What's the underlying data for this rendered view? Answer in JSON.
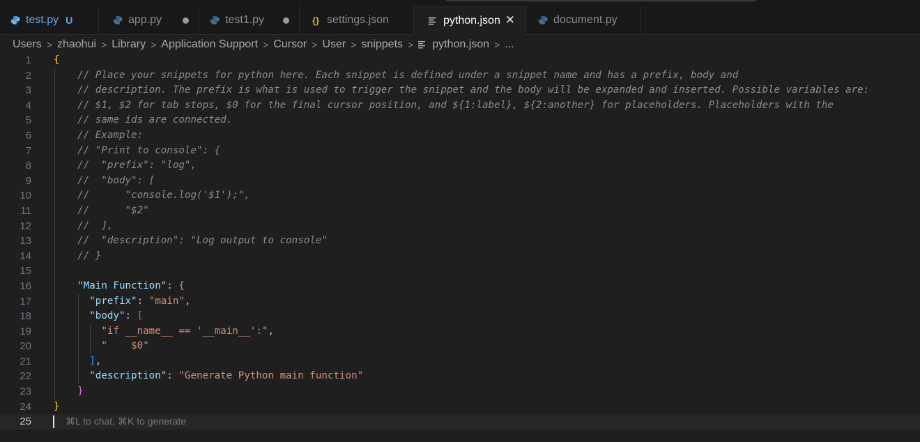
{
  "tabs": [
    {
      "label": "test.py",
      "icon": "python-icon",
      "marker": "U",
      "state": "modified-untracked"
    },
    {
      "label": "app.py",
      "icon": "python-icon",
      "marker": "dot",
      "state": "unsaved"
    },
    {
      "label": "test1.py",
      "icon": "python-icon",
      "marker": "dot",
      "state": "unsaved"
    },
    {
      "label": "settings.json",
      "icon": "json-braces-icon",
      "marker": "",
      "state": "normal"
    },
    {
      "label": "python.json",
      "icon": "lines-file-icon",
      "marker": "close",
      "state": "active"
    },
    {
      "label": "document.py",
      "icon": "python-icon",
      "marker": "",
      "state": "normal"
    }
  ],
  "breadcrumb": {
    "items": [
      "Users",
      "zhaohui",
      "Library",
      "Application Support",
      "Cursor",
      "User",
      "snippets"
    ],
    "file": "python.json",
    "ellipsis": "..."
  },
  "editor": {
    "current_line": 25,
    "inline_hint": "⌘L to chat, ⌘K to generate",
    "lines": [
      "{",
      "    // Place your snippets for python here. Each snippet is defined under a snippet name and has a prefix, body and",
      "    // description. The prefix is what is used to trigger the snippet and the body will be expanded and inserted. Possible variables are:",
      "    // $1, $2 for tab stops, $0 for the final cursor position, and ${1:label}, ${2:another} for placeholders. Placeholders with the",
      "    // same ids are connected.",
      "    // Example:",
      "    // \"Print to console\": {",
      "    //  \"prefix\": \"log\",",
      "    //  \"body\": [",
      "    //      \"console.log('$1');\",",
      "    //      \"$2\"",
      "    //  ],",
      "    //  \"description\": \"Log output to console\"",
      "    // }",
      "",
      "    \"Main Function\": {",
      "      \"prefix\": \"main\",",
      "      \"body\": [",
      "        \"if __name__ == '__main__':\",",
      "        \"    $0\"",
      "      ],",
      "      \"description\": \"Generate Python main function\"",
      "    }",
      "}",
      ""
    ]
  },
  "colors": {
    "background": "#1f1f1f",
    "comment": "#8b8b8b",
    "json_key": "#9cdcfe",
    "json_string": "#ce9178",
    "bracket_gold": "#ffd700",
    "bracket_orchid": "#da70d6",
    "bracket_blue": "#179fff",
    "untracked_marker": "#5aa0e6"
  }
}
